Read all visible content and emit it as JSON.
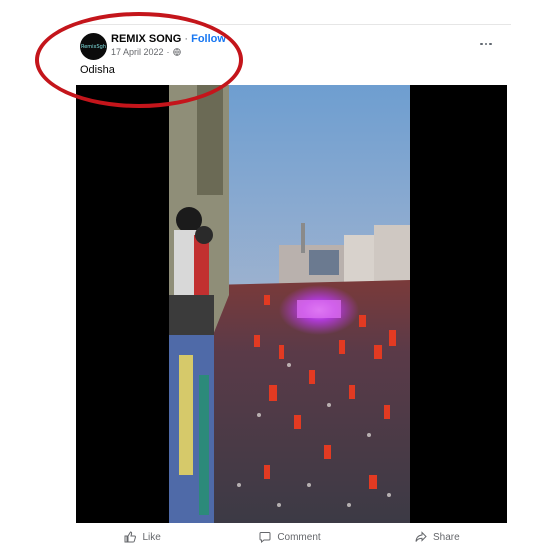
{
  "post": {
    "author": "REMIX SONG",
    "separator": "·",
    "follow_label": "Follow",
    "date": "17 April 2022",
    "date_separator": "·",
    "avatar_text": "RemixSgh",
    "caption": "Odisha",
    "privacy_icon": "globe-icon",
    "more_icon": "ellipsis-icon"
  },
  "media": {
    "type": "video",
    "description_icon": "crowd-video"
  },
  "actions": [
    {
      "label": "Like",
      "icon": "thumbs-up-icon"
    },
    {
      "label": "Comment",
      "icon": "comment-icon"
    },
    {
      "label": "Share",
      "icon": "share-icon"
    }
  ],
  "annotation": {
    "color": "#c4151b",
    "shape": "ellipse"
  },
  "colors": {
    "follow": "#1877f2",
    "text_secondary": "#65676b"
  }
}
